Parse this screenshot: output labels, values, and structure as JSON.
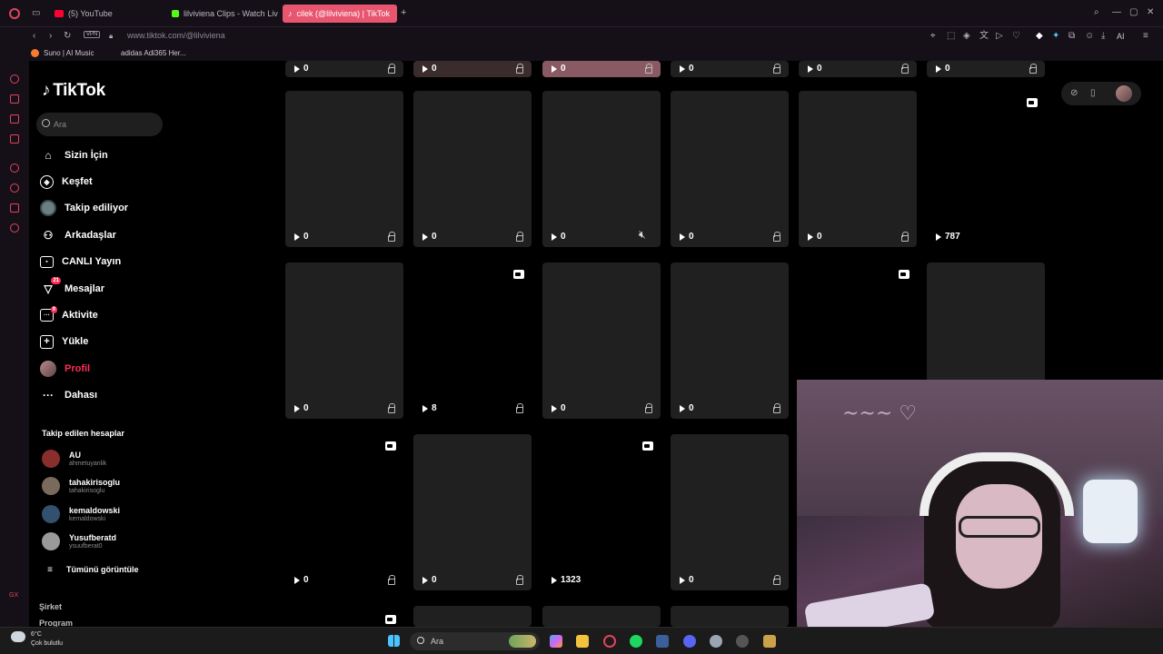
{
  "browser": {
    "tabs": [
      {
        "label": "(5) YouTube",
        "active": false,
        "color": "#ff0033"
      },
      {
        "label": "lilviviena Clips - Watch Liv",
        "active": false,
        "color": "#53fc18"
      },
      {
        "label": "cilek (@lilviviena) | TikTok",
        "active": true,
        "color": "#ffffff"
      }
    ],
    "url": "www.tiktok.com/@lilviviena",
    "vpn": "VPN",
    "ai_label": "AI",
    "bookmarks": [
      "Suno | AI Music",
      "adidas Adi365 Her..."
    ],
    "gx": "GX"
  },
  "tiktok": {
    "logo": "TikTok",
    "search_placeholder": "Ara",
    "nav": [
      {
        "label": "Sizin İçin",
        "icon": "home-icon"
      },
      {
        "label": "Keşfet",
        "icon": "compass-icon"
      },
      {
        "label": "Takip ediliyor",
        "icon": "following-avatar"
      },
      {
        "label": "Arkadaşlar",
        "icon": "friends-icon"
      },
      {
        "label": "CANLI Yayın",
        "icon": "live-icon"
      },
      {
        "label": "Mesajlar",
        "icon": "message-icon",
        "badge": "21"
      },
      {
        "label": "Aktivite",
        "icon": "activity-icon",
        "badge": "9"
      },
      {
        "label": "Yükle",
        "icon": "upload-icon"
      },
      {
        "label": "Profil",
        "icon": "profile-avatar"
      },
      {
        "label": "Dahası",
        "icon": "more-icon"
      }
    ],
    "following_title": "Takip edilen hesaplar",
    "following": [
      {
        "name": "AU",
        "handle": "ahmetuyanlik"
      },
      {
        "name": "tahakirisoglu",
        "handle": "tahakirisoglu"
      },
      {
        "name": "kemaldowski",
        "handle": "kemaldowski"
      },
      {
        "name": "Yusufberatd",
        "handle": "ysuufberat0"
      }
    ],
    "see_all": "Tümünü görüntüle",
    "footer": [
      "Şirket",
      "Program"
    ]
  },
  "grid": {
    "top_row_counts": [
      "0",
      "0",
      "0",
      "0",
      "0",
      "0"
    ],
    "rows": [
      [
        "0",
        "0",
        "0",
        "0",
        "0",
        "787"
      ],
      [
        "0",
        "8",
        "0",
        "0",
        "",
        ""
      ],
      [
        "0",
        "0",
        "1323",
        "0"
      ]
    ]
  },
  "taskbar": {
    "temperature": "6°C",
    "weather": "Çok bulutlu",
    "search": "Ara"
  }
}
